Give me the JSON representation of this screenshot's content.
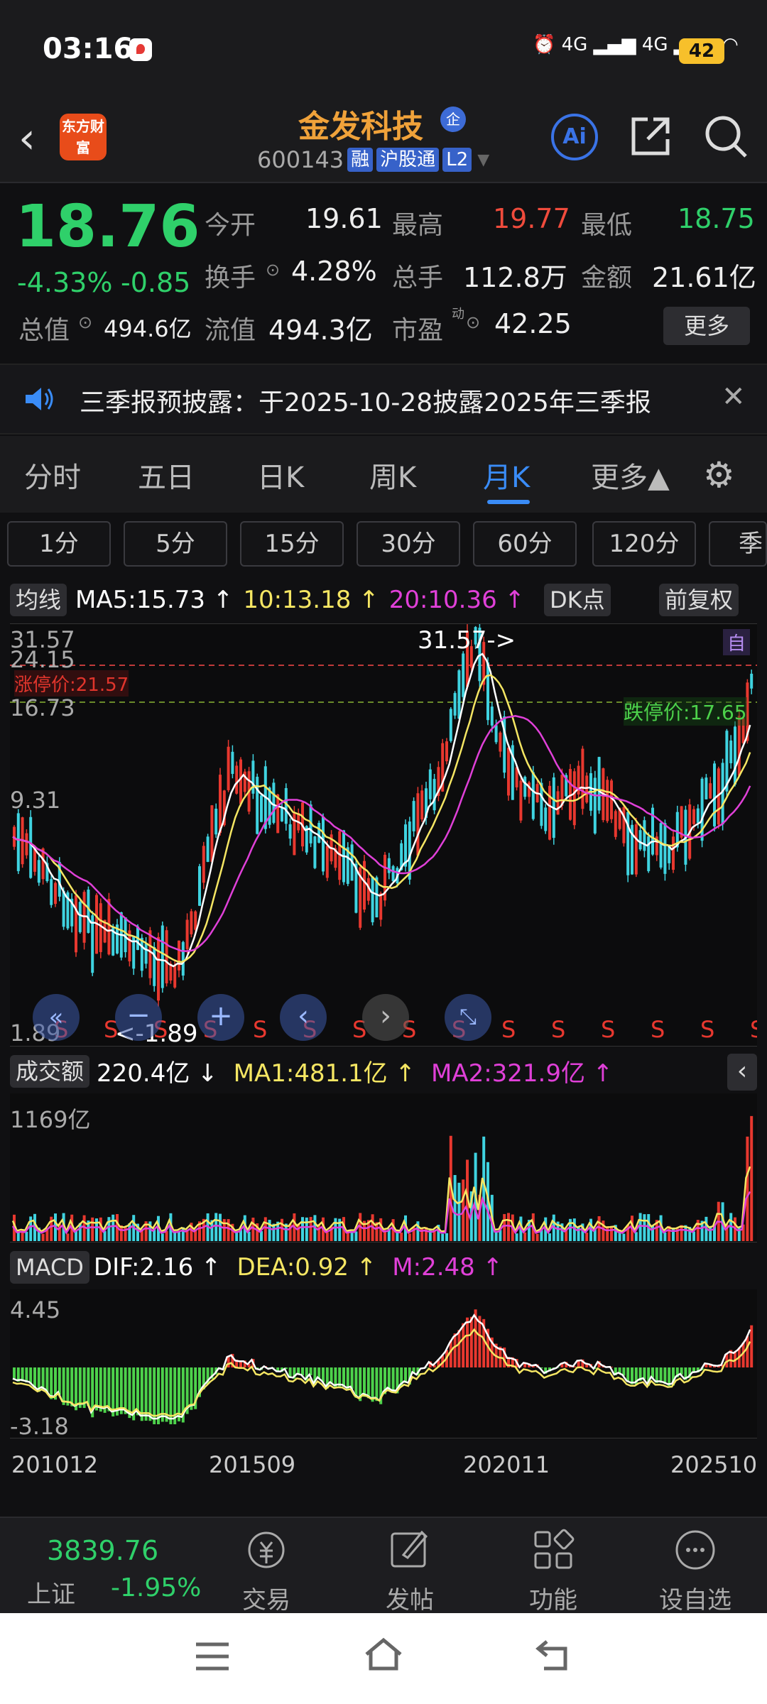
{
  "status": {
    "time": "03:16",
    "signals": "⏰ 4G ▂▄▆ 4G ▂▄▆ ◠",
    "battery": "42"
  },
  "header": {
    "back_icon": "chevron-left-icon",
    "logo_text": "东方财富",
    "stock_name": "金发科技",
    "qi_badge": "企",
    "code": "600143",
    "tags": [
      "融",
      "沪股通",
      "L2"
    ],
    "ai_label": "Ai"
  },
  "quote": {
    "price": "18.76",
    "change_pct": "-4.33%",
    "change_amt": "-0.85",
    "open_label": "今开",
    "open": "19.61",
    "high_label": "最高",
    "high": "19.77",
    "low_label": "最低",
    "low": "18.75",
    "turnover_label": "换手",
    "turnover": "4.28%",
    "volume_label": "总手",
    "volume": "112.8万",
    "amount_label": "金额",
    "amount": "21.61亿",
    "mktcap_label": "总值",
    "mktcap": "494.6亿",
    "float_label": "流值",
    "float": "494.3亿",
    "pe_label": "市盈",
    "pe_sup": "动",
    "pe": "42.25",
    "more": "更多"
  },
  "notice": {
    "text": "三季报预披露：于2025-10-28披露2025年三季报"
  },
  "tabs": [
    "分时",
    "五日",
    "日K",
    "周K",
    "月K",
    "更多▲"
  ],
  "minute_buttons": [
    "1分",
    "5分",
    "15分",
    "30分",
    "60分",
    "120分",
    "季"
  ],
  "kline": {
    "indicator": "均线",
    "ma5": "MA5:15.73 ↑",
    "ma10": "10:13.18 ↑",
    "ma20": "20:10.36 ↑",
    "dk": "DK点",
    "adjust": "前复权",
    "y_labels": [
      "31.57",
      "24.15",
      "16.73",
      "9.31",
      "1.89"
    ],
    "limit_up": "涨停价:21.57",
    "limit_down": "跌停价:17.65",
    "max_label": "31.57->",
    "min_label": "<-1.89",
    "self_tag": "自",
    "colors": {
      "ma5": "#ffffff",
      "ma10": "#f5e663",
      "ma20": "#e040d8",
      "up": "#e8382f",
      "down": "#3fd3e0"
    }
  },
  "volume": {
    "indicator": "成交额",
    "value": "220.4亿 ↓",
    "ma1": "MA1:481.1亿 ↑",
    "ma2": "MA2:321.9亿 ↑",
    "y_label": "1169亿"
  },
  "macd": {
    "indicator": "MACD",
    "dif": "DIF:2.16 ↑",
    "dea": "DEA:0.92 ↑",
    "m": "M:2.48 ↑",
    "y_top": "4.45",
    "y_bottom": "-3.18"
  },
  "x_labels": [
    "201012",
    "201509",
    "202011",
    "202510"
  ],
  "bottom": {
    "index_value": "3839.76",
    "index_name": "上证",
    "index_change": "-1.95%",
    "nav": [
      "交易",
      "发帖",
      "功能",
      "设自选"
    ]
  }
}
